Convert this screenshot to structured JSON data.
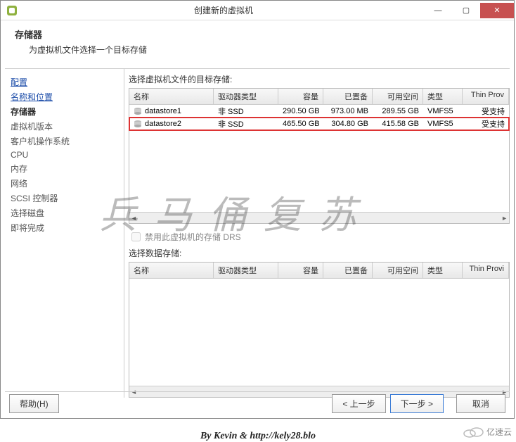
{
  "window": {
    "title": "创建新的虚拟机",
    "min": "—",
    "max": "▢",
    "close": "✕"
  },
  "header": {
    "title": "存储器",
    "subtitle": "为虚拟机文件选择一个目标存储"
  },
  "sidebar": {
    "steps": [
      {
        "label": "配置",
        "link": true
      },
      {
        "label": "名称和位置",
        "link": true
      },
      {
        "label": "存储器",
        "current": true
      },
      {
        "label": "虚拟机版本"
      },
      {
        "label": "客户机操作系统"
      },
      {
        "label": "CPU"
      },
      {
        "label": "内存"
      },
      {
        "label": "网络"
      },
      {
        "label": "SCSI 控制器"
      },
      {
        "label": "选择磁盘"
      },
      {
        "label": "即将完成"
      }
    ]
  },
  "main": {
    "prompt": "选择虚拟机文件的目标存储:",
    "columns": {
      "name": "名称",
      "drive": "驱动器类型",
      "cap": "容量",
      "prov": "已置备",
      "free": "可用空间",
      "type": "类型",
      "thin": "Thin Prov"
    },
    "rows": [
      {
        "name": "datastore1",
        "drive": "非 SSD",
        "cap": "290.50 GB",
        "prov": "973.00 MB",
        "free": "289.55 GB",
        "type": "VMFS5",
        "thin": "受支持"
      },
      {
        "name": "datastore2",
        "drive": "非 SSD",
        "cap": "465.50 GB",
        "prov": "304.80 GB",
        "free": "415.58 GB",
        "type": "VMFS5",
        "thin": "受支持"
      }
    ],
    "disable_drs": "禁用此虚拟机的存储 DRS",
    "select_ds": "选择数据存储:",
    "columns2": {
      "name": "名称",
      "drive": "驱动器类型",
      "cap": "容量",
      "prov": "已置备",
      "free": "可用空间",
      "type": "类型",
      "thin": "Thin Provi"
    }
  },
  "footer": {
    "help": "帮助(H)",
    "back": "< 上一步",
    "next": "下一步 >",
    "cancel": "取消"
  },
  "watermark": "兵马俑复苏",
  "credit": "By Kevin & http://kely28.blo",
  "corner": "亿速云"
}
